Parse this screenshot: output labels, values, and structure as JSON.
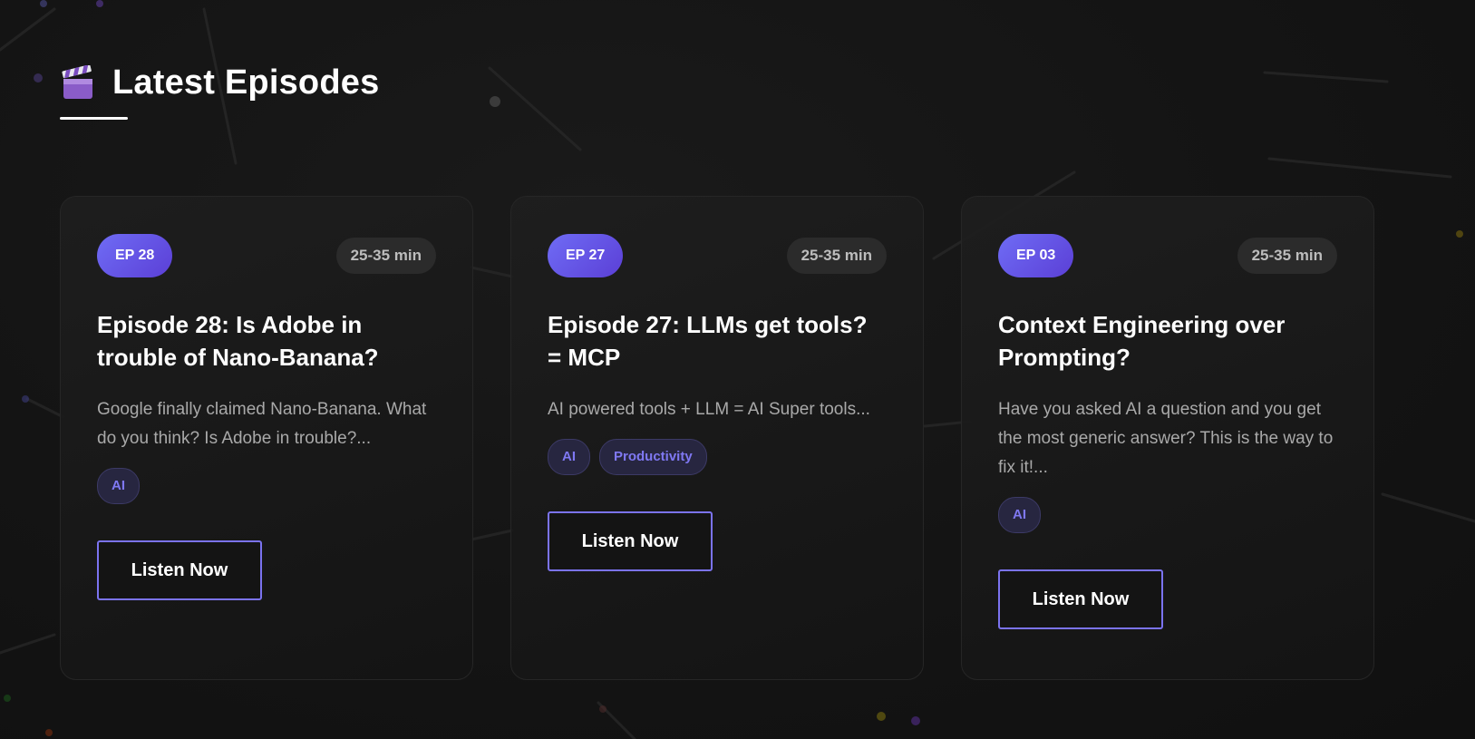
{
  "section": {
    "icon": "clapperboard-icon",
    "title": "Latest Episodes"
  },
  "colors": {
    "accent": "#6f6cf5",
    "background": "#121212",
    "card_border": "#262626",
    "tag_text": "#7f78f2"
  },
  "episodes": [
    {
      "badge": "EP 28",
      "duration": "25-35 min",
      "title": "Episode 28: Is Adobe in trouble of Nano-Banana?",
      "description": "Google finally claimed Nano-Banana. What do you think? Is Adobe in trouble?...",
      "tags": [
        "AI"
      ],
      "button": "Listen Now"
    },
    {
      "badge": "EP 27",
      "duration": "25-35 min",
      "title": "Episode 27: LLMs get tools? = MCP",
      "description": "AI powered tools + LLM = AI Super tools...",
      "tags": [
        "AI",
        "Productivity"
      ],
      "button": "Listen Now"
    },
    {
      "badge": "EP 03",
      "duration": "25-35 min",
      "title": "Context Engineering over Prompting?",
      "description": "Have you asked AI a question and you get the most generic answer? This is the way to fix it!...",
      "tags": [
        "AI"
      ],
      "button": "Listen Now"
    }
  ]
}
